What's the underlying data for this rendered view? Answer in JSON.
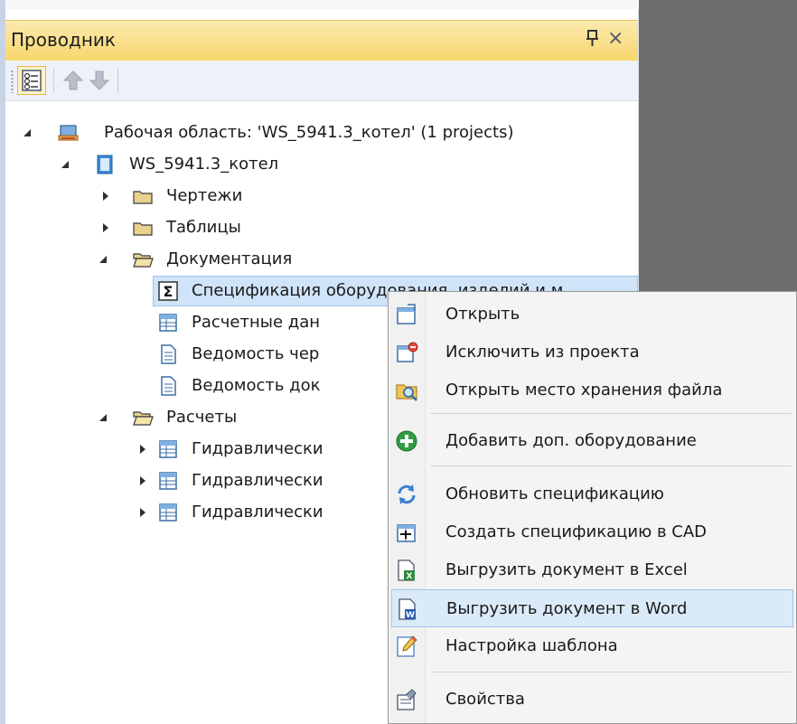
{
  "panel": {
    "title": "Проводник",
    "pin_icon": "pin-icon",
    "close_symbol": "×"
  },
  "toolbar": {
    "buttons": [
      "properties-view-icon",
      "move-up-icon",
      "move-down-icon"
    ]
  },
  "tree": {
    "workspace": "Рабочая область: 'WS_5941.3_котел' (1 projects)",
    "project": "WS_5941.3_котел",
    "folders": {
      "drawings": "Чертежи",
      "tables": "Таблицы",
      "documentation": "Документация",
      "calculations": "Расчеты"
    },
    "doc_items": [
      "Спецификация оборудования, изделий и м",
      "Расчетные дан",
      "Ведомость чер",
      "Ведомость док"
    ],
    "calc_items": [
      "Гидравлически",
      "Гидравлически",
      "Гидравлически"
    ]
  },
  "context_menu": {
    "items": [
      {
        "label": "Открыть",
        "icon": "open-doc-icon"
      },
      {
        "label": "Исключить из проекта",
        "icon": "exclude-doc-icon"
      },
      {
        "label": "Открыть место хранения файла",
        "icon": "folder-search-icon"
      },
      {
        "label": "Добавить доп. оборудование",
        "icon": "green-plus-icon"
      },
      {
        "label": "Обновить спецификацию",
        "icon": "refresh-icon"
      },
      {
        "label": "Создать спецификацию в CAD",
        "icon": "cad-table-icon"
      },
      {
        "label": "Выгрузить документ в Excel",
        "icon": "excel-export-icon"
      },
      {
        "label": "Выгрузить документ в Word",
        "icon": "word-export-icon"
      },
      {
        "label": "Настройка шаблона",
        "icon": "pencil-template-icon"
      },
      {
        "label": "Свойства",
        "icon": "properties-icon"
      }
    ],
    "highlighted_index": 7
  },
  "colors": {
    "header": "#f7d76a",
    "selection": "#cfe4f8",
    "right_area": "#6e6e6e",
    "menu_bg": "#f4f4f4"
  }
}
